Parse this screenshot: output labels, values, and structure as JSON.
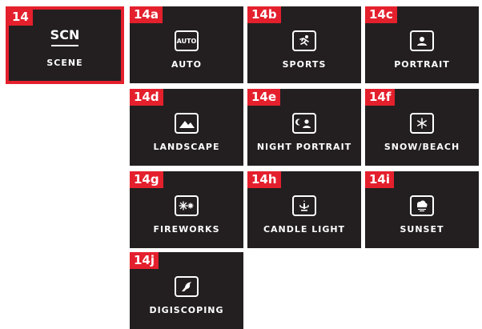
{
  "colors": {
    "accent": "#e4202d",
    "tile": "#231f20",
    "text": "#ffffff"
  },
  "scene": {
    "tag": "14",
    "mode": "SCN",
    "label": "SCENE",
    "icon": "scn-text"
  },
  "modes": [
    {
      "tag": "14a",
      "label": "AUTO",
      "icon": "auto-icon",
      "icon_text": "AUTO"
    },
    {
      "tag": "14b",
      "label": "SPORTS",
      "icon": "runner-icon"
    },
    {
      "tag": "14c",
      "label": "PORTRAIT",
      "icon": "portrait-icon"
    },
    {
      "tag": "14d",
      "label": "LANDSCAPE",
      "icon": "mountain-icon"
    },
    {
      "tag": "14e",
      "label": "NIGHT PORTRAIT",
      "icon": "night-portrait-icon"
    },
    {
      "tag": "14f",
      "label": "SNOW/BEACH",
      "icon": "snowflake-icon"
    },
    {
      "tag": "14g",
      "label": "FIREWORKS",
      "icon": "fireworks-icon"
    },
    {
      "tag": "14h",
      "label": "CANDLE LIGHT",
      "icon": "candle-icon"
    },
    {
      "tag": "14i",
      "label": "SUNSET",
      "icon": "sunset-icon"
    },
    {
      "tag": "14j",
      "label": "DIGISCOPING",
      "icon": "bird-icon"
    }
  ]
}
